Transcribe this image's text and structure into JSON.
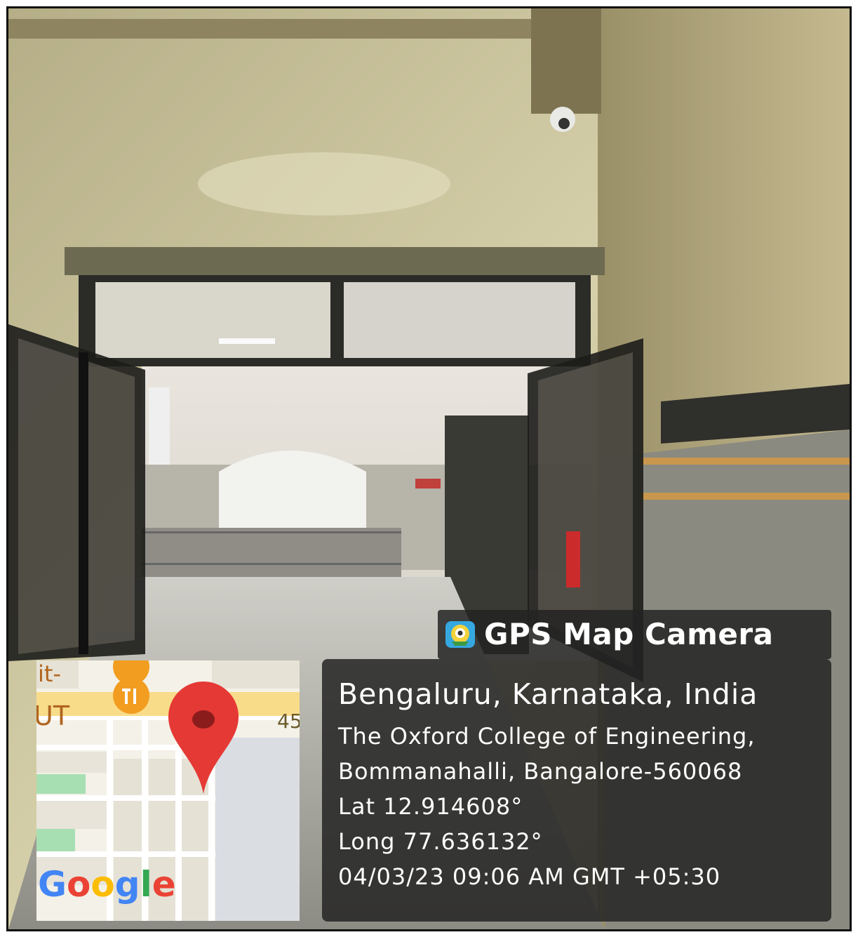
{
  "overlay": {
    "app_name": "GPS Map Camera",
    "app_icon": "gps-map-camera-icon",
    "location_title": "Bengaluru, Karnataka, India",
    "address_line_1": "The Oxford College of Engineering,",
    "address_line_2": "Bommanahalli, Bangalore-560068",
    "latitude": "Lat 12.914608°",
    "longitude": "Long 77.636132°",
    "timestamp": "04/03/23 09:06 AM GMT +05:30"
  },
  "map": {
    "logo_text": "Google",
    "road_label": "45",
    "place_label_top": "it-",
    "place_label_bottom": "UT",
    "marker_icon": "location-pin-icon",
    "poi_icon": "restaurant-icon"
  },
  "colors": {
    "pin_red": "#e53935",
    "poi_orange": "#f29d1f",
    "panel_bg": "#232323",
    "road_yellow": "#f8dc8a"
  }
}
